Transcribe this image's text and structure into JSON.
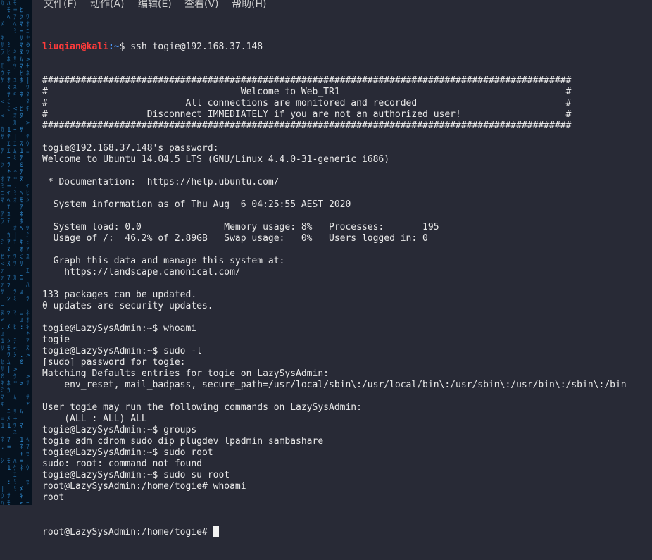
{
  "menubar": {
    "items": [
      "文件(F)",
      "动作(A)",
      "编辑(E)",
      "查看(V)",
      "帮助(H)"
    ]
  },
  "prompt": {
    "user": "liuqian",
    "at": "@",
    "host": "kali",
    "path": ":~",
    "symbol": "$ ",
    "command": "ssh togie@192.168.37.148"
  },
  "terminal": {
    "lines": [
      "################################################################################################",
      "#                                   Welcome to Web_TR1                                         #",
      "#                         All connections are monitored and recorded                           #",
      "#                  Disconnect IMMEDIATELY if you are not an authorized user!                   #",
      "################################################################################################",
      "",
      "togie@192.168.37.148's password:",
      "Welcome to Ubuntu 14.04.5 LTS (GNU/Linux 4.4.0-31-generic i686)",
      "",
      " * Documentation:  https://help.ubuntu.com/",
      "",
      "  System information as of Thu Aug  6 04:25:55 AEST 2020",
      "",
      "  System load: 0.0               Memory usage: 8%   Processes:       195",
      "  Usage of /:  46.2% of 2.89GB   Swap usage:   0%   Users logged in: 0",
      "",
      "  Graph this data and manage this system at:",
      "    https://landscape.canonical.com/",
      "",
      "133 packages can be updated.",
      "0 updates are security updates.",
      "",
      "togie@LazySysAdmin:~$ whoami",
      "togie",
      "togie@LazySysAdmin:~$ sudo -l",
      "[sudo] password for togie:",
      "Matching Defaults entries for togie on LazySysAdmin:",
      "    env_reset, mail_badpass, secure_path=/usr/local/sbin\\:/usr/local/bin\\:/usr/sbin\\:/usr/bin\\:/sbin\\:/bin",
      "",
      "User togie may run the following commands on LazySysAdmin:",
      "    (ALL : ALL) ALL",
      "togie@LazySysAdmin:~$ groups",
      "togie adm cdrom sudo dip plugdev lpadmin sambashare",
      "togie@LazySysAdmin:~$ sudo root",
      "sudo: root: command not found",
      "togie@LazySysAdmin:~$ sudo su root",
      "root@LazySysAdmin:/home/togie# whoami",
      "root"
    ],
    "last_prompt": "root@LazySysAdmin:/home/togie# "
  },
  "colors": {
    "background": "#282a36",
    "text": "#e8e8e8",
    "prompt_user": "#ff3b3b",
    "prompt_path": "#4f9dff",
    "sidebar_glyphs": "#2f8fd8"
  }
}
